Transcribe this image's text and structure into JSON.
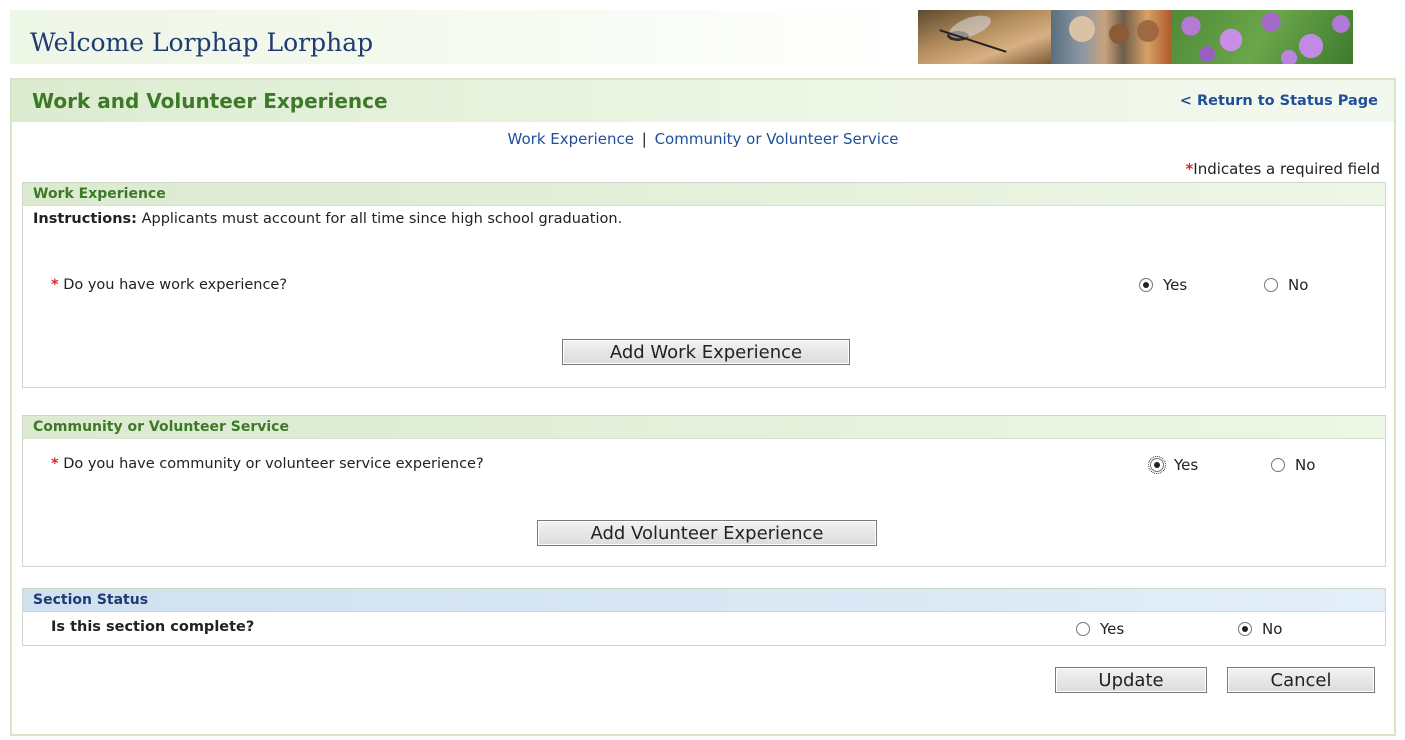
{
  "header": {
    "welcome": "Welcome Lorphap Lorphap",
    "images": [
      "mosquito-photo",
      "people-photo",
      "bacteria-photo"
    ]
  },
  "page": {
    "title": "Work and Volunteer Experience",
    "return_link": "< Return to Status Page",
    "subnav": {
      "work": "Work Experience",
      "separator": "|",
      "volunteer": "Community or Volunteer Service"
    },
    "required_star": "*",
    "required_note": "Indicates a required field"
  },
  "work_section": {
    "header": "Work Experience",
    "instructions_label": "Instructions:",
    "instructions_text": "Applicants must account for all time since high school graduation.",
    "question": "Do you have work experience?",
    "yes_label": "Yes",
    "no_label": "No",
    "selected": "Yes",
    "add_button": "Add Work Experience"
  },
  "volunteer_section": {
    "header": "Community or Volunteer Service",
    "question": "Do you have community or volunteer service experience?",
    "yes_label": "Yes",
    "no_label": "No",
    "selected": "Yes",
    "add_button": "Add Volunteer Experience"
  },
  "status_section": {
    "header": "Section Status",
    "question": "Is this section complete?",
    "yes_label": "Yes",
    "no_label": "No",
    "selected": "No"
  },
  "actions": {
    "update": "Update",
    "cancel": "Cancel"
  },
  "colors": {
    "title_green": "#3c7a27",
    "link_blue": "#1f4f9a",
    "required_red": "#d42a2a"
  }
}
